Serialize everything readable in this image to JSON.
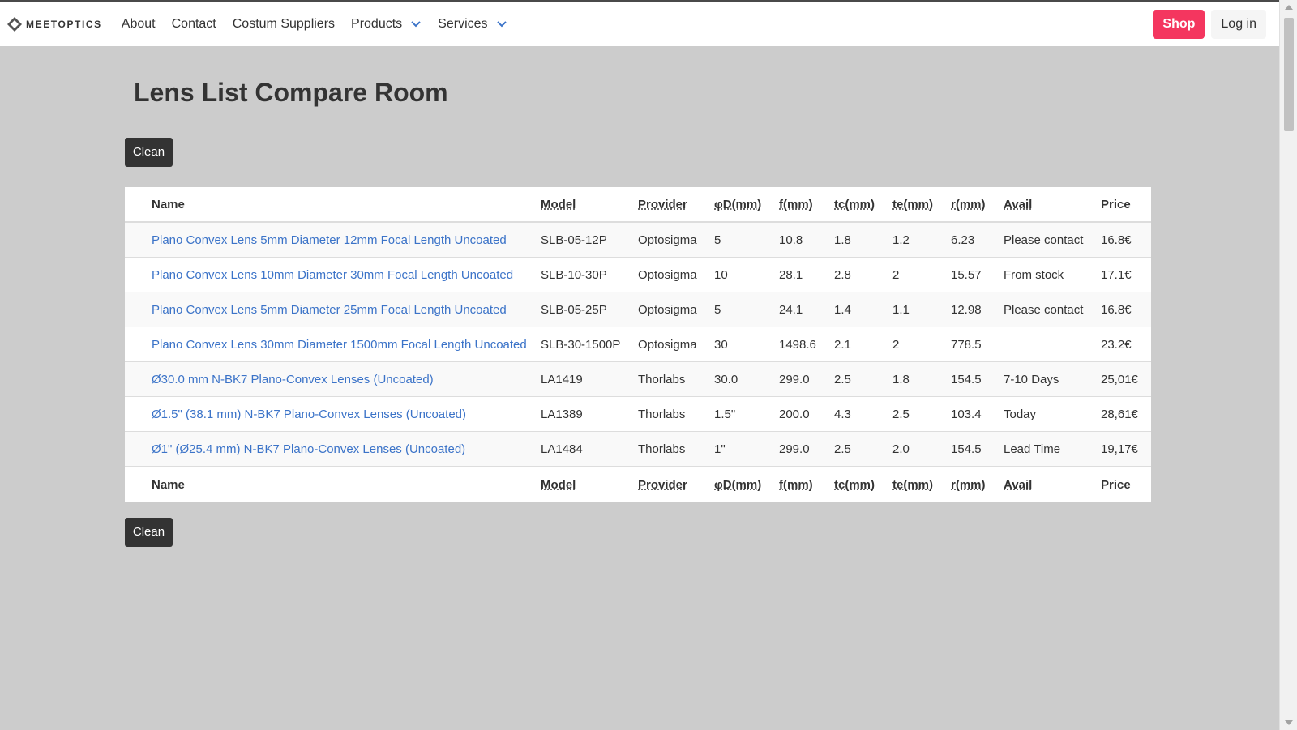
{
  "nav": {
    "brand": "MEETOPTICS",
    "items": [
      {
        "label": "About"
      },
      {
        "label": "Contact"
      },
      {
        "label": "Costum Suppliers"
      },
      {
        "label": "Products"
      },
      {
        "label": "Services"
      }
    ],
    "shop_label": "Shop",
    "login_label": "Log in"
  },
  "page": {
    "title": "Lens List Compare Room",
    "clean_label": "Clean"
  },
  "table": {
    "columns": [
      "Name",
      "Model",
      "Provider",
      "φD(mm)",
      "f(mm)",
      "tc(mm)",
      "te(mm)",
      "r(mm)",
      "Avail",
      "Price"
    ],
    "rows": [
      {
        "name": "Plano Convex Lens 5mm Diameter 12mm Focal Length Uncoated",
        "model": "SLB-05-12P",
        "provider": "Optosigma",
        "d": "5",
        "f": "10.8",
        "tc": "1.8",
        "te": "1.2",
        "r": "6.23",
        "avail": "Please contact",
        "price": "16.8€"
      },
      {
        "name": "Plano Convex Lens 10mm Diameter 30mm Focal Length Uncoated",
        "model": "SLB-10-30P",
        "provider": "Optosigma",
        "d": "10",
        "f": "28.1",
        "tc": "2.8",
        "te": "2",
        "r": "15.57",
        "avail": "From stock",
        "price": "17.1€"
      },
      {
        "name": "Plano Convex Lens 5mm Diameter 25mm Focal Length Uncoated",
        "model": "SLB-05-25P",
        "provider": "Optosigma",
        "d": "5",
        "f": "24.1",
        "tc": "1.4",
        "te": "1.1",
        "r": "12.98",
        "avail": "Please contact",
        "price": "16.8€"
      },
      {
        "name": "Plano Convex Lens 30mm Diameter 1500mm Focal Length Uncoated",
        "model": "SLB-30-1500P",
        "provider": "Optosigma",
        "d": "30",
        "f": "1498.6",
        "tc": "2.1",
        "te": "2",
        "r": "778.5",
        "avail": "",
        "price": "23.2€"
      },
      {
        "name": "Ø30.0 mm N-BK7 Plano-Convex Lenses (Uncoated)",
        "model": "LA1419",
        "provider": "Thorlabs",
        "d": "30.0",
        "f": "299.0",
        "tc": "2.5",
        "te": "1.8",
        "r": "154.5",
        "avail": "7-10 Days",
        "price": "25,01€"
      },
      {
        "name": "Ø1.5\" (38.1 mm) N-BK7 Plano-Convex Lenses (Uncoated)",
        "model": "LA1389",
        "provider": "Thorlabs",
        "d": "1.5\"",
        "f": "200.0",
        "tc": "4.3",
        "te": "2.5",
        "r": "103.4",
        "avail": "Today",
        "price": "28,61€"
      },
      {
        "name": "Ø1\" (Ø25.4 mm) N-BK7 Plano-Convex Lenses (Uncoated)",
        "model": "LA1484",
        "provider": "Thorlabs",
        "d": "1\"",
        "f": "299.0",
        "tc": "2.5",
        "te": "2.0",
        "r": "154.5",
        "avail": "Lead Time",
        "price": "19,17€"
      }
    ]
  },
  "colors": {
    "accent": "#f4365f",
    "link": "#3b73c8",
    "background": "#cccccc",
    "dark_button": "#333333"
  }
}
